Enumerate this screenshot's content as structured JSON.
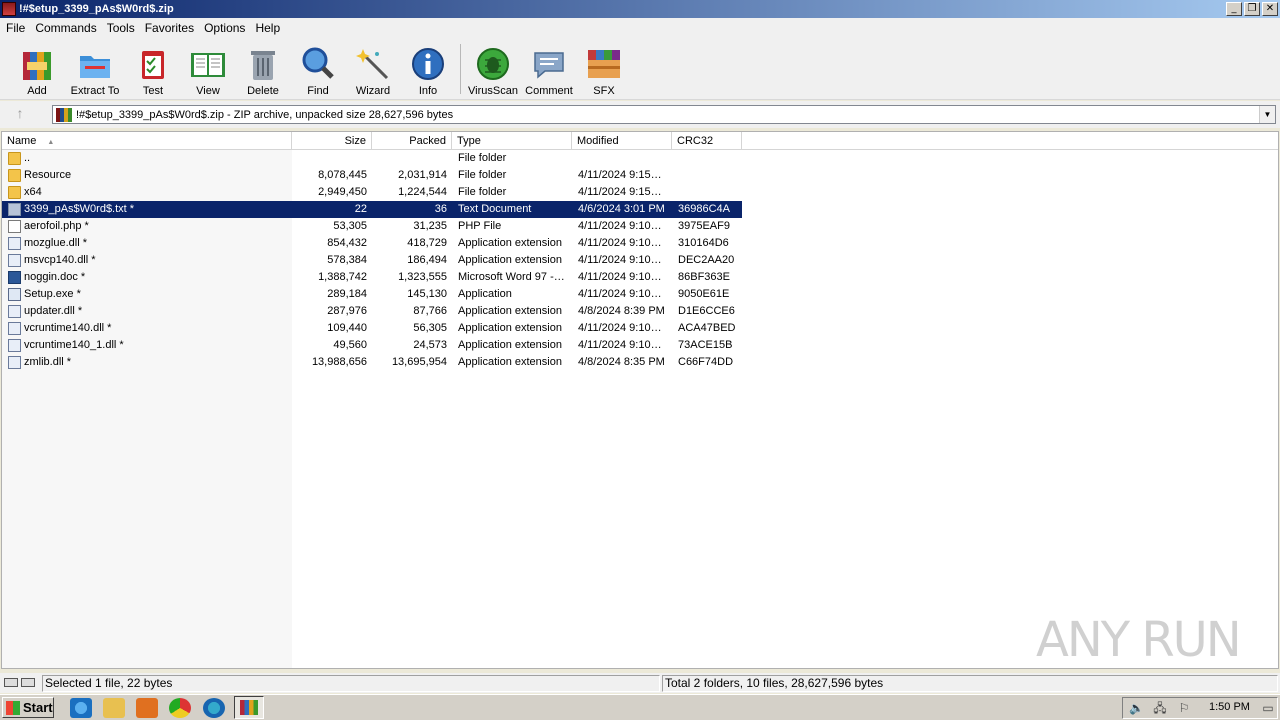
{
  "window": {
    "title": "!#$etup_3399_pAs$W0rd$.zip",
    "minimize": "_",
    "restore": "❐",
    "close": "✕"
  },
  "menu": [
    "File",
    "Commands",
    "Tools",
    "Favorites",
    "Options",
    "Help"
  ],
  "toolbar": [
    {
      "label": "Add",
      "icon": "add-archive-icon"
    },
    {
      "label": "Extract To",
      "icon": "extract-folder-icon"
    },
    {
      "label": "Test",
      "icon": "test-clipboard-icon"
    },
    {
      "label": "View",
      "icon": "view-book-icon"
    },
    {
      "label": "Delete",
      "icon": "trash-icon"
    },
    {
      "label": "Find",
      "icon": "magnifier-icon"
    },
    {
      "label": "Wizard",
      "icon": "wand-icon"
    },
    {
      "label": "Info",
      "icon": "info-icon"
    },
    {
      "label": "VirusScan",
      "icon": "bug-icon"
    },
    {
      "label": "Comment",
      "icon": "comment-icon"
    },
    {
      "label": "SFX",
      "icon": "sfx-box-icon"
    }
  ],
  "address": {
    "up": "↑",
    "text": "!#$etup_3399_pAs$W0rd$.zip - ZIP archive, unpacked size 28,627,596 bytes",
    "dropdown": "▼"
  },
  "columns": [
    "Name",
    "Size",
    "Packed",
    "Type",
    "Modified",
    "CRC32"
  ],
  "sort_indicator": "▲",
  "files": [
    {
      "name": "..",
      "size": "",
      "packed": "",
      "type": "File folder",
      "modified": "",
      "crc": "",
      "icon": "folder"
    },
    {
      "name": "Resource",
      "size": "8,078,445",
      "packed": "2,031,914",
      "type": "File folder",
      "modified": "4/11/2024 9:15…",
      "crc": "",
      "icon": "folder"
    },
    {
      "name": "x64",
      "size": "2,949,450",
      "packed": "1,224,544",
      "type": "File folder",
      "modified": "4/11/2024 9:15…",
      "crc": "",
      "icon": "folder"
    },
    {
      "name": "3399_pAs$W0rd$.txt *",
      "size": "22",
      "packed": "36",
      "type": "Text Document",
      "modified": "4/6/2024 3:01 PM",
      "crc": "36986C4A",
      "icon": "txt",
      "selected": true
    },
    {
      "name": "aerofoil.php *",
      "size": "53,305",
      "packed": "31,235",
      "type": "PHP File",
      "modified": "4/11/2024 9:10…",
      "crc": "3975EAF9",
      "icon": "doc"
    },
    {
      "name": "mozglue.dll *",
      "size": "854,432",
      "packed": "418,729",
      "type": "Application extension",
      "modified": "4/11/2024 9:10…",
      "crc": "310164D6",
      "icon": "dll"
    },
    {
      "name": "msvcp140.dll *",
      "size": "578,384",
      "packed": "186,494",
      "type": "Application extension",
      "modified": "4/11/2024 9:10…",
      "crc": "DEC2AA20",
      "icon": "dll"
    },
    {
      "name": "noggin.doc *",
      "size": "1,388,742",
      "packed": "1,323,555",
      "type": "Microsoft Word 97 -…",
      "modified": "4/11/2024 9:10…",
      "crc": "86BF363E",
      "icon": "word"
    },
    {
      "name": "Setup.exe *",
      "size": "289,184",
      "packed": "145,130",
      "type": "Application",
      "modified": "4/11/2024 9:10…",
      "crc": "9050E61E",
      "icon": "exe"
    },
    {
      "name": "updater.dll *",
      "size": "287,976",
      "packed": "87,766",
      "type": "Application extension",
      "modified": "4/8/2024 8:39 PM",
      "crc": "D1E6CCE6",
      "icon": "dll"
    },
    {
      "name": "vcruntime140.dll *",
      "size": "109,440",
      "packed": "56,305",
      "type": "Application extension",
      "modified": "4/11/2024 9:10…",
      "crc": "ACA47BED",
      "icon": "dll"
    },
    {
      "name": "vcruntime140_1.dll *",
      "size": "49,560",
      "packed": "24,573",
      "type": "Application extension",
      "modified": "4/11/2024 9:10…",
      "crc": "73ACE15B",
      "icon": "dll"
    },
    {
      "name": "zmlib.dll *",
      "size": "13,988,656",
      "packed": "13,695,954",
      "type": "Application extension",
      "modified": "4/8/2024 8:35 PM",
      "crc": "C66F74DD",
      "icon": "dll"
    }
  ],
  "status": {
    "left": "Selected 1 file, 22 bytes",
    "right": "Total 2 folders, 10 files, 28,627,596 bytes"
  },
  "watermark": "ANY RUN",
  "taskbar": {
    "start": "Start",
    "clock": "1:50 PM"
  }
}
